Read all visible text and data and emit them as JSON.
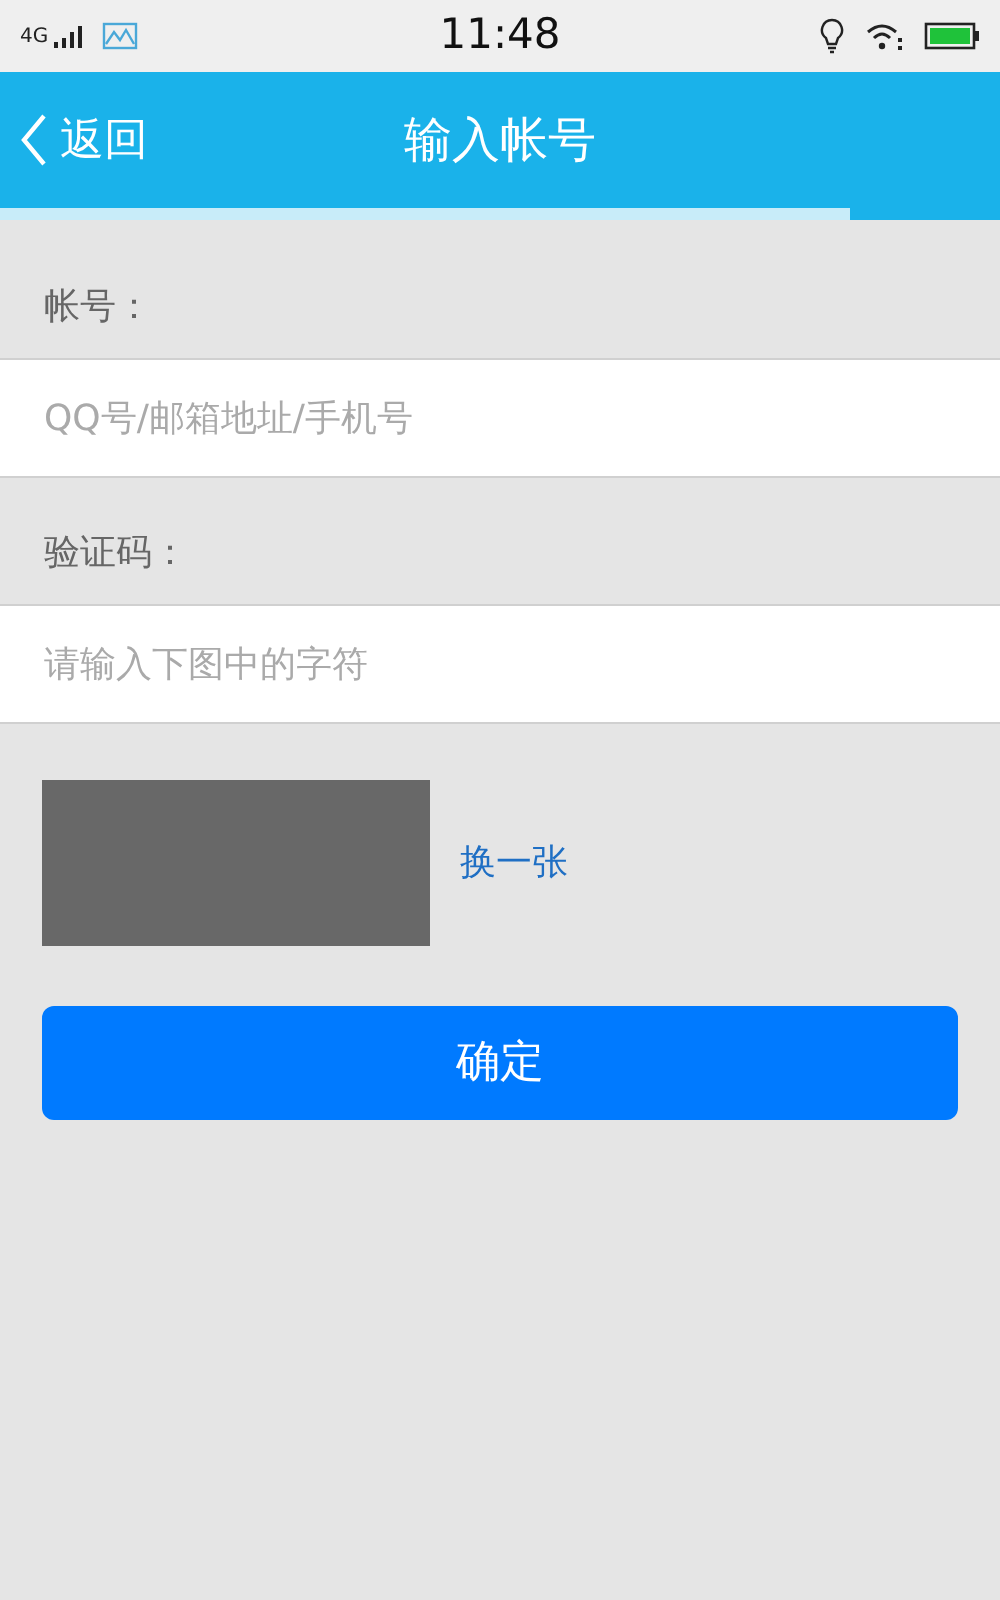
{
  "status_bar": {
    "network": "4G",
    "time": "11:48"
  },
  "header": {
    "back": "返回",
    "title": "输入帐号",
    "progress": {
      "level": 0.85
    }
  },
  "account": {
    "label": "帐号：",
    "placeholder": "QQ号/邮箱地址/手机号"
  },
  "captcha": {
    "label": "验证码：",
    "placeholder": "请输入下图中的字符",
    "refresh": "换一张"
  },
  "submit": "确定"
}
